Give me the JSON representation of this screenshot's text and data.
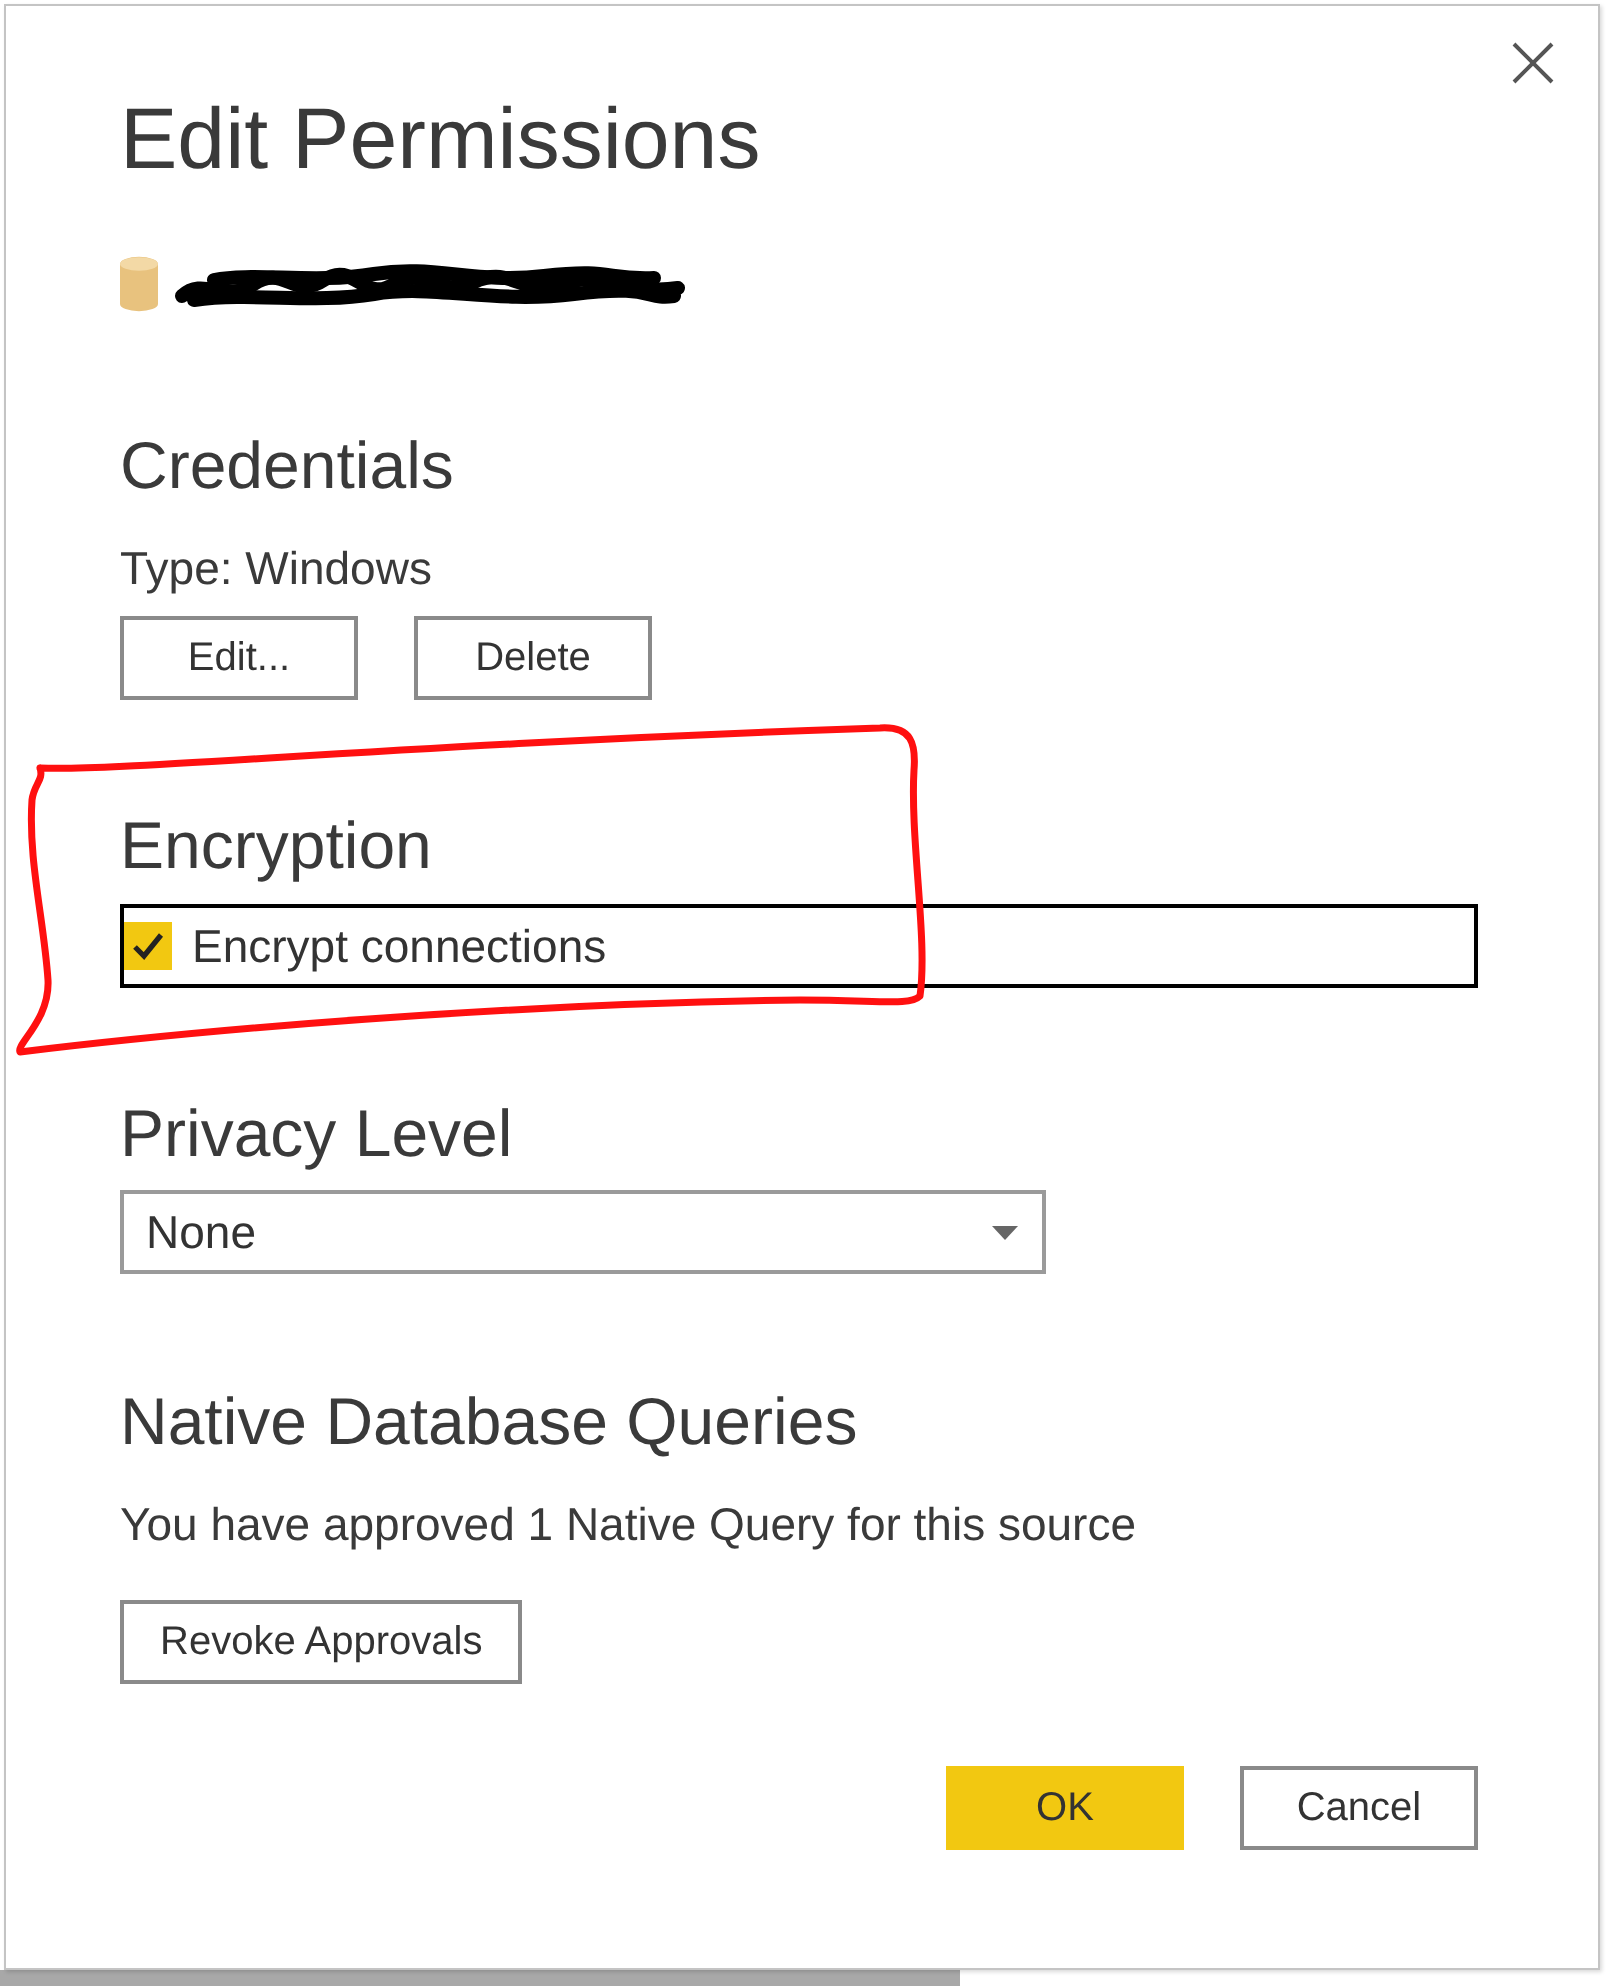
{
  "window": {
    "title": "Edit Permissions"
  },
  "credentials": {
    "heading": "Credentials",
    "type_label": "Type: Windows",
    "buttons": [
      "Edit...",
      "Delete"
    ]
  },
  "encryption": {
    "heading": "Encryption",
    "checkbox": {
      "label": "Encrypt connections",
      "checked": true,
      "focused": true
    }
  },
  "privacy_level": {
    "heading": "Privacy Level",
    "dropdown": {
      "value": "None"
    }
  },
  "native_queries": {
    "heading": "Native Database Queries",
    "message": "You have approved 1 Native Query for this source",
    "button": "Revoke Approvals"
  },
  "footer_buttons": [
    {
      "label": "OK",
      "kind": "primary"
    },
    {
      "label": "Cancel",
      "kind": "secondary"
    }
  ]
}
